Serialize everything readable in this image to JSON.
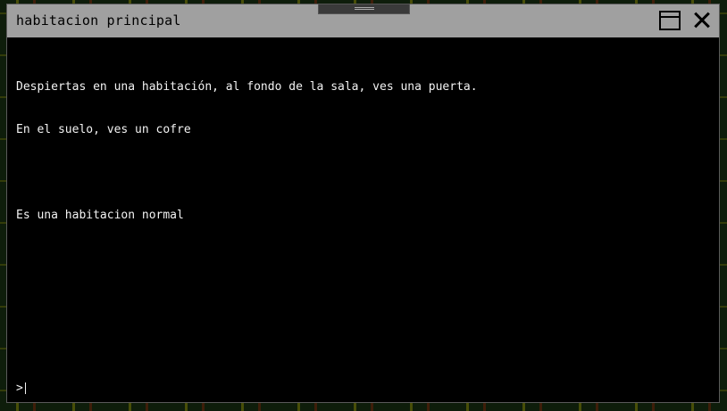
{
  "window": {
    "title": "habitacion principal",
    "accent_titlebar": "#a0a0a0",
    "console_bg": "#000000",
    "text_color": "#f2f2f2"
  },
  "titlebar_icons": {
    "drag": "drag-handle-icon",
    "maximize": "maximize-icon",
    "close": "close-icon"
  },
  "console": {
    "lines": [
      "Despiertas en una habitación, al fondo de la sala, ves una puerta.",
      "En el suelo, ves un cofre",
      "",
      "Es una habitacion normal"
    ],
    "prompt": ">",
    "input_value": ""
  }
}
